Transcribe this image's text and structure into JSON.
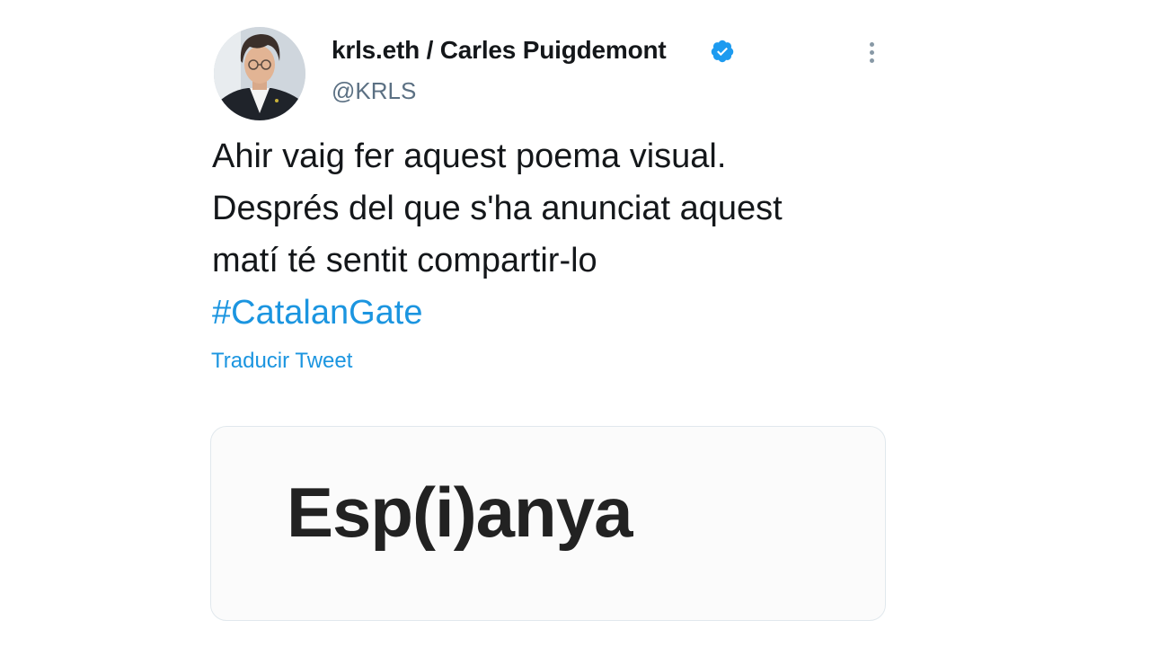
{
  "tweet": {
    "display_name": "krls.eth / Carles Puigdemont",
    "handle": "@KRLS",
    "verified_icon": "verified-badge-icon",
    "more_icon": "more-options-icon",
    "text_lines": [
      "Ahir vaig fer aquest poema visual.",
      "Després del que s'ha anunciat aquest",
      "matí té sentit compartir-lo"
    ],
    "hashtag": "#CatalanGate",
    "translate_label": "Traducir Tweet",
    "media_text": "Esp(i)anya"
  },
  "colors": {
    "link": "#1b95e0",
    "verified": "#1d9bf0",
    "text": "#14171a",
    "secondary": "#5b7083"
  }
}
